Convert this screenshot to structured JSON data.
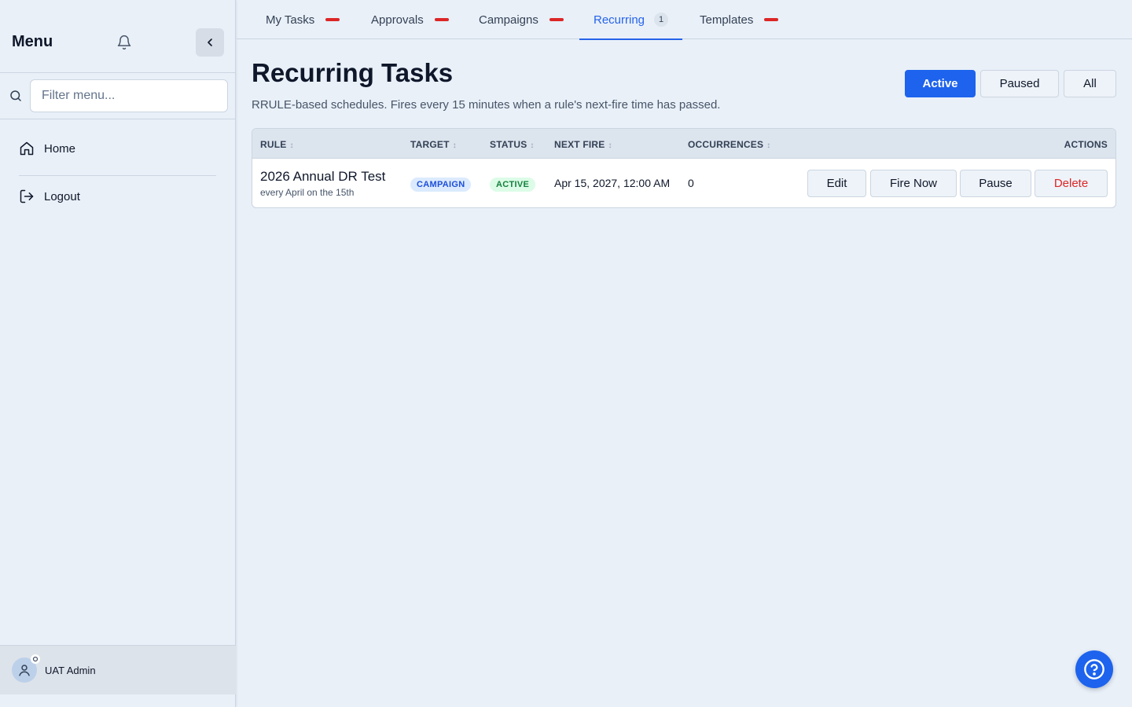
{
  "sidebar": {
    "title": "Menu",
    "filter_placeholder": "Filter menu...",
    "items": [
      {
        "label": "Home",
        "icon": "home-icon"
      },
      {
        "label": "Logout",
        "icon": "logout-icon"
      }
    ],
    "user": {
      "name": "UAT Admin"
    }
  },
  "tabs": [
    {
      "label": "My Tasks",
      "indicator": "dash"
    },
    {
      "label": "Approvals",
      "indicator": "dash"
    },
    {
      "label": "Campaigns",
      "indicator": "dash"
    },
    {
      "label": "Recurring",
      "count": "1",
      "active": true
    },
    {
      "label": "Templates",
      "indicator": "dash"
    }
  ],
  "main": {
    "title": "Recurring Tasks",
    "subtitle": "RRULE-based schedules. Fires every 15 minutes when a rule's next-fire time has passed.",
    "filters": [
      {
        "label": "Active",
        "selected": true
      },
      {
        "label": "Paused"
      },
      {
        "label": "All"
      }
    ]
  },
  "table": {
    "headers": {
      "rule": "RULE",
      "target": "TARGET",
      "status": "STATUS",
      "next_fire": "NEXT FIRE",
      "occurrences": "OCCURRENCES",
      "actions": "ACTIONS"
    },
    "sort_glyph": "↕",
    "rows": [
      {
        "name": "2026 Annual DR Test",
        "schedule": "every April on the 15th",
        "target": "CAMPAIGN",
        "status": "ACTIVE",
        "next_fire": "Apr 15, 2027, 12:00 AM",
        "occurrences": "0",
        "actions": {
          "edit": "Edit",
          "fire_now": "Fire Now",
          "pause": "Pause",
          "delete": "Delete"
        }
      }
    ]
  },
  "colors": {
    "accent": "#1d63ed",
    "danger": "#dc2626",
    "tab_active": "#2563eb",
    "badge_target_bg": "#dbeafe",
    "badge_status_bg": "#dcfce7"
  }
}
